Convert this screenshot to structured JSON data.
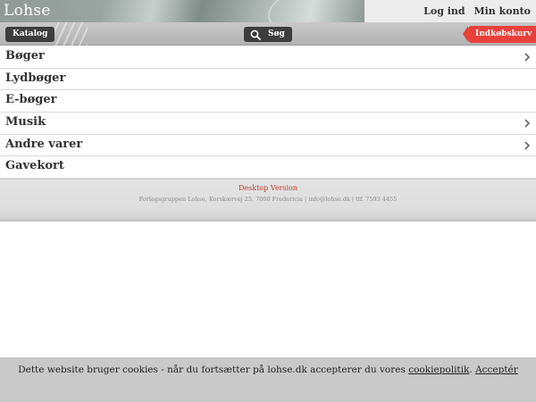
{
  "header": {
    "logo": "Lohse",
    "login_label": "Log ind",
    "account_label": "Min konto"
  },
  "toolbar": {
    "catalog_label": "Katalog",
    "search_label": "Søg",
    "cart_label": "Indkøbskurv"
  },
  "menu": {
    "items": [
      {
        "label": "Bøger",
        "has_submenu": true
      },
      {
        "label": "Lydbøger",
        "has_submenu": false
      },
      {
        "label": "E-bøger",
        "has_submenu": false
      },
      {
        "label": "Musik",
        "has_submenu": true
      },
      {
        "label": "Andre varer",
        "has_submenu": true
      },
      {
        "label": "Gavekort",
        "has_submenu": false
      }
    ]
  },
  "footer": {
    "desktop_link": "Desktop Version",
    "address": "Forlagsgruppen Lohse, Korskærvej 25, 7000 Fredericia | info@lohse.dk | tlf. 7593 4455"
  },
  "cookie": {
    "text": "Dette website bruger cookies - når du fortsætter på lohse.dk accepterer du vores",
    "policy_link": "cookiepolitik",
    "separator": ".",
    "accept_link": "Acceptér"
  },
  "colors": {
    "cart_red": "#e8413b",
    "toolbar_button": "#3d3d3d",
    "link_red": "#c0392b"
  },
  "icons": {
    "search": "search-icon",
    "chevron": "chevron-right-icon"
  }
}
